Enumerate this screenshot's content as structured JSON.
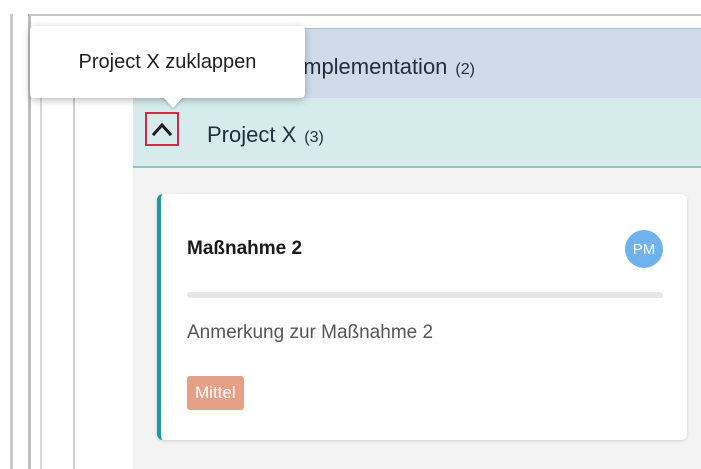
{
  "tooltip": {
    "text": "Project X zuklappen"
  },
  "group": {
    "title": "Implementation",
    "count": "(2)"
  },
  "subgroup": {
    "title": "Project X",
    "count": "(3)",
    "collapse_icon": "chevron-up-icon"
  },
  "card": {
    "title": "Maßnahme 2",
    "avatar": "PM",
    "note": "Anmerkung zur Maßnahme 2",
    "priority": "Mittel"
  },
  "colors": {
    "group_bg": "#cfdbe8",
    "subgroup_bg": "#d6ecec",
    "card_accent": "#1e9a98",
    "avatar_bg": "#6fb3ee",
    "priority_bg": "#e6a087",
    "focus_outline": "#cf2a4a"
  }
}
